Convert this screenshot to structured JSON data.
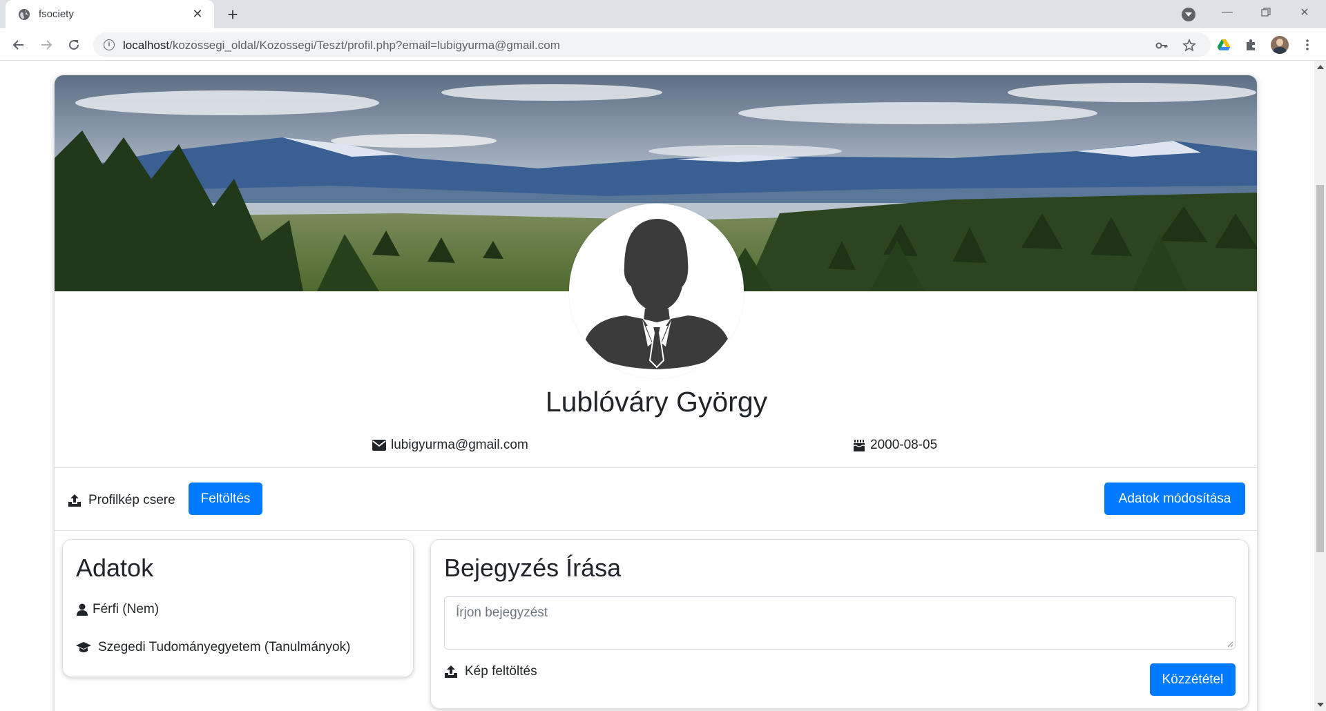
{
  "browser": {
    "tab_title": "fsociety",
    "url_host": "localhost",
    "url_rest": "/kozossegi_oldal/Kozossegi/Teszt/profil.php?email=lubigyurma@gmail.com"
  },
  "profile": {
    "name": "Lublóváry György",
    "email": "lubigyurma@gmail.com",
    "birthdate": "2000-08-05"
  },
  "actions": {
    "profile_pic_label": "Profilkép csere",
    "upload_button": "Feltöltés",
    "edit_data_button": "Adatok módosítása"
  },
  "data_card": {
    "title": "Adatok",
    "gender": "Férfi (Nem)",
    "studies": "Szegedi Tudományegyetem (Tanulmányok)"
  },
  "post_card": {
    "title": "Bejegyzés Írása",
    "placeholder": "Írjon bejegyzést",
    "image_upload_label": "Kép feltöltés",
    "publish_button": "Közzététel"
  },
  "colors": {
    "primary": "#007bff",
    "tabstrip": "#dee1e6",
    "omnibox": "#f1f3f4"
  }
}
